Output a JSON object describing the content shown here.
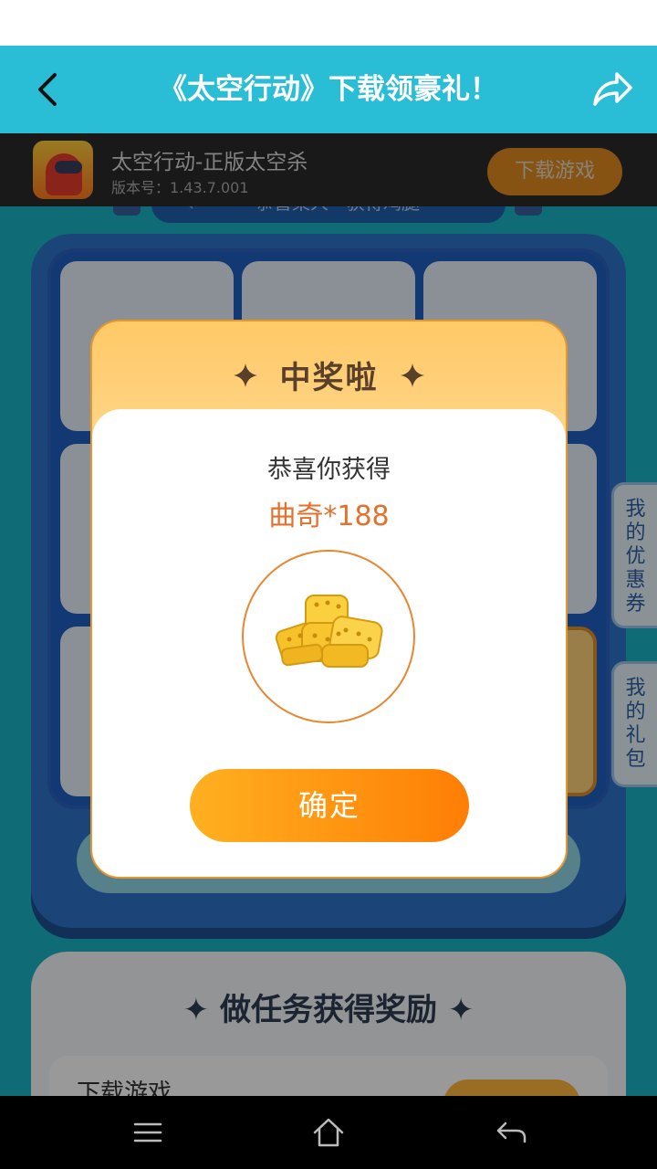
{
  "header": {
    "title": "《太空行动》下载领豪礼！",
    "back_icon": "chevron-left-icon",
    "share_icon": "share-icon",
    "background": "#2abdd6"
  },
  "app_bar": {
    "name": "太空行动-正版太空杀",
    "version": "版本号：1.43.7.001",
    "download_label": "下载游戏"
  },
  "ticker": {
    "text": "恭喜某人**获得鸡腿",
    "icon": "speaker-icon"
  },
  "side_tabs": [
    {
      "label": "我的优惠券"
    },
    {
      "label": "我的礼包"
    }
  ],
  "tasks": {
    "title": "做任务获得奖励",
    "items": [
      {
        "label": "下载游戏"
      }
    ]
  },
  "modal": {
    "title": "中奖啦",
    "congrats": "恭喜你获得",
    "prize": "曲奇*188",
    "prize_icon": "cookie-icon",
    "confirm_label": "确定",
    "accent": "#ff8a10",
    "prize_color": "#e5702b"
  },
  "nav": {
    "menu_icon": "menu-icon",
    "home_icon": "home-icon",
    "back_icon": "back-arrow-icon"
  }
}
